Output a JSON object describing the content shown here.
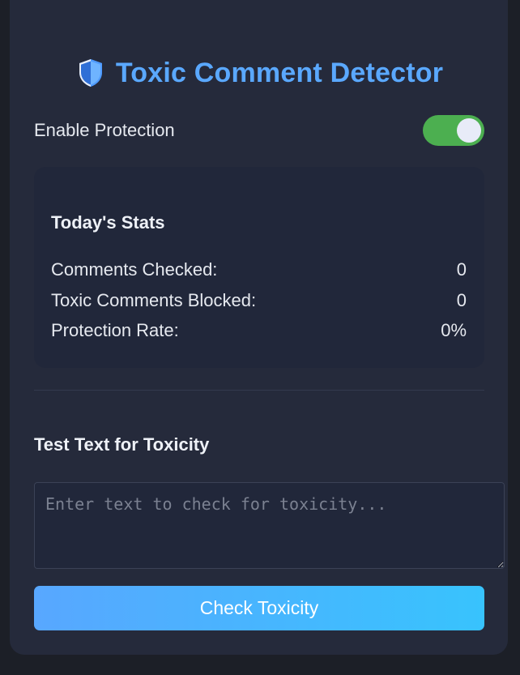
{
  "header": {
    "title": "Toxic Comment Detector",
    "icon": "shield-icon"
  },
  "protection": {
    "label": "Enable Protection",
    "enabled": true
  },
  "stats": {
    "title": "Today's Stats",
    "rows": [
      {
        "label": "Comments Checked:",
        "value": "0"
      },
      {
        "label": "Toxic Comments Blocked:",
        "value": "0"
      },
      {
        "label": "Protection Rate:",
        "value": "0%"
      }
    ]
  },
  "tester": {
    "title": "Test Text for Toxicity",
    "value": "",
    "placeholder": "Enter text to check for toxicity...",
    "button_label": "Check Toxicity"
  },
  "colors": {
    "accent": "#5aa8ff",
    "toggle_on": "#4caf50",
    "button_gradient_start": "#58a7ff",
    "button_gradient_end": "#38c3fd",
    "panel_bg": "#252a3b",
    "page_bg": "#1c1f27"
  }
}
